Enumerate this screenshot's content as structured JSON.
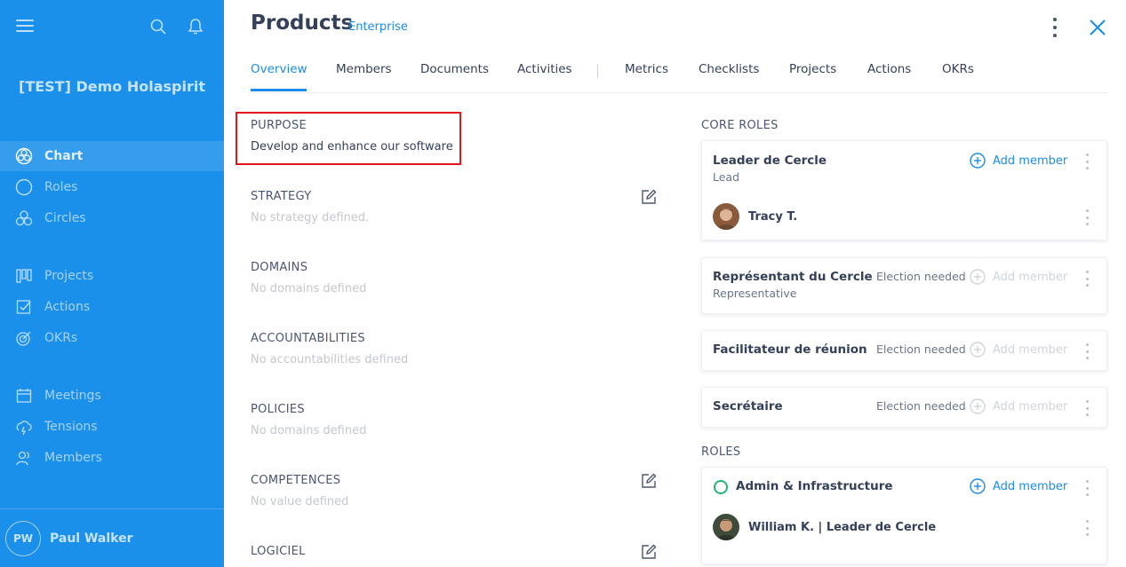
{
  "sidebar": {
    "org_name": "[TEST] Demo Holaspirit",
    "nav": [
      {
        "label": "Chart",
        "icon": "chart-icon"
      },
      {
        "label": "Roles",
        "icon": "roles-icon"
      },
      {
        "label": "Circles",
        "icon": "circles-icon"
      },
      {
        "label": "Projects",
        "icon": "projects-icon"
      },
      {
        "label": "Actions",
        "icon": "actions-icon"
      },
      {
        "label": "OKRs",
        "icon": "okrs-icon"
      },
      {
        "label": "Meetings",
        "icon": "meetings-icon"
      },
      {
        "label": "Tensions",
        "icon": "tensions-icon"
      },
      {
        "label": "Members",
        "icon": "members-icon"
      }
    ],
    "user_initials": "PW",
    "user_name": "Paul Walker"
  },
  "header": {
    "title": "Products",
    "subtitle": "Enterprise"
  },
  "tabs": [
    "Overview",
    "Members",
    "Documents",
    "Activities",
    "Metrics",
    "Checklists",
    "Projects",
    "Actions",
    "OKRs"
  ],
  "sections": {
    "purpose": {
      "label": "PURPOSE",
      "value": "Develop and enhance our software"
    },
    "strategy": {
      "label": "STRATEGY",
      "value": "No strategy defined."
    },
    "domains": {
      "label": "DOMAINS",
      "value": "No domains defined"
    },
    "accountabilities": {
      "label": "ACCOUNTABILITIES",
      "value": "No accountabilities defined"
    },
    "policies": {
      "label": "POLICIES",
      "value": "No domains defined"
    },
    "competences": {
      "label": "COMPETENCES",
      "value": "No value defined"
    },
    "logiciel": {
      "label": "LOGICIEL"
    }
  },
  "core_roles": {
    "label": "CORE ROLES",
    "items": [
      {
        "name": "Leader de Cercle",
        "type": "Lead",
        "member": "Tracy T.",
        "add_label": "Add member"
      },
      {
        "name": "Représentant du Cercle",
        "type": "Representative",
        "status": "Election needed",
        "add_label": "Add member"
      },
      {
        "name": "Facilitateur de réunion",
        "status": "Election needed",
        "add_label": "Add member"
      },
      {
        "name": "Secrétaire",
        "status": "Election needed",
        "add_label": "Add member"
      }
    ]
  },
  "roles": {
    "label": "ROLES",
    "items": [
      {
        "name": "Admin & Infrastructure",
        "member": "William K. | Leader de Cercle",
        "add_label": "Add member"
      }
    ]
  },
  "colors": {
    "sidebar": "#1b90ea",
    "accent": "#1b8ce8",
    "highlight": "#e3151a",
    "role_circle": "#22b573"
  }
}
